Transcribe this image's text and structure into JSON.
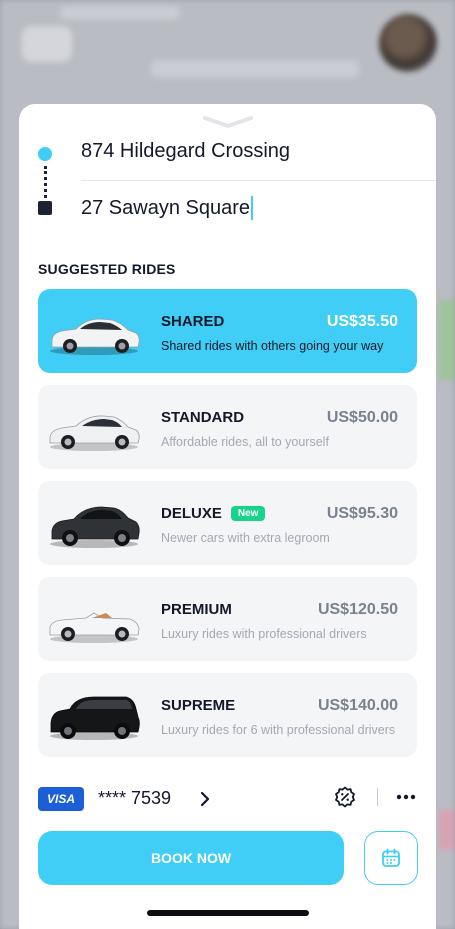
{
  "route": {
    "from": "874 Hildegard Crossing",
    "to": "27 Sawayn Square"
  },
  "rides": {
    "title": "SUGGESTED RIDES",
    "items": [
      {
        "name": "SHARED",
        "price": "US$35.50",
        "desc": "Shared rides with others going your way",
        "selected": true,
        "car_color": "#f2f3f5"
      },
      {
        "name": "STANDARD",
        "price": "US$50.00",
        "desc": "Affordable rides, all to yourself",
        "selected": false,
        "car_color": "#eef0f2"
      },
      {
        "name": "DELUXE",
        "price": "US$95.30",
        "desc": "Newer cars with extra legroom",
        "selected": false,
        "badge": "New",
        "car_color": "#2f3236"
      },
      {
        "name": "PREMIUM",
        "price": "US$120.50",
        "desc": "Luxury rides with professional drivers",
        "selected": false,
        "car_color": "#f4f5f6"
      },
      {
        "name": "SUPREME",
        "price": "US$140.00",
        "desc": "Luxury rides for 6 with professional drivers",
        "selected": false,
        "car_color": "#151618"
      }
    ]
  },
  "payment": {
    "brand": "VISA",
    "card": "**** 7539",
    "icons": [
      "chevron-right-icon",
      "promo-discount-icon",
      "more-dots-icon"
    ]
  },
  "actions": {
    "book": "BOOK NOW",
    "schedule_icon": "calendar-icon"
  },
  "colors": {
    "accent": "#40cef6",
    "text": "#14182b",
    "badge": "#19d38c",
    "visa": "#1a5fd6"
  }
}
